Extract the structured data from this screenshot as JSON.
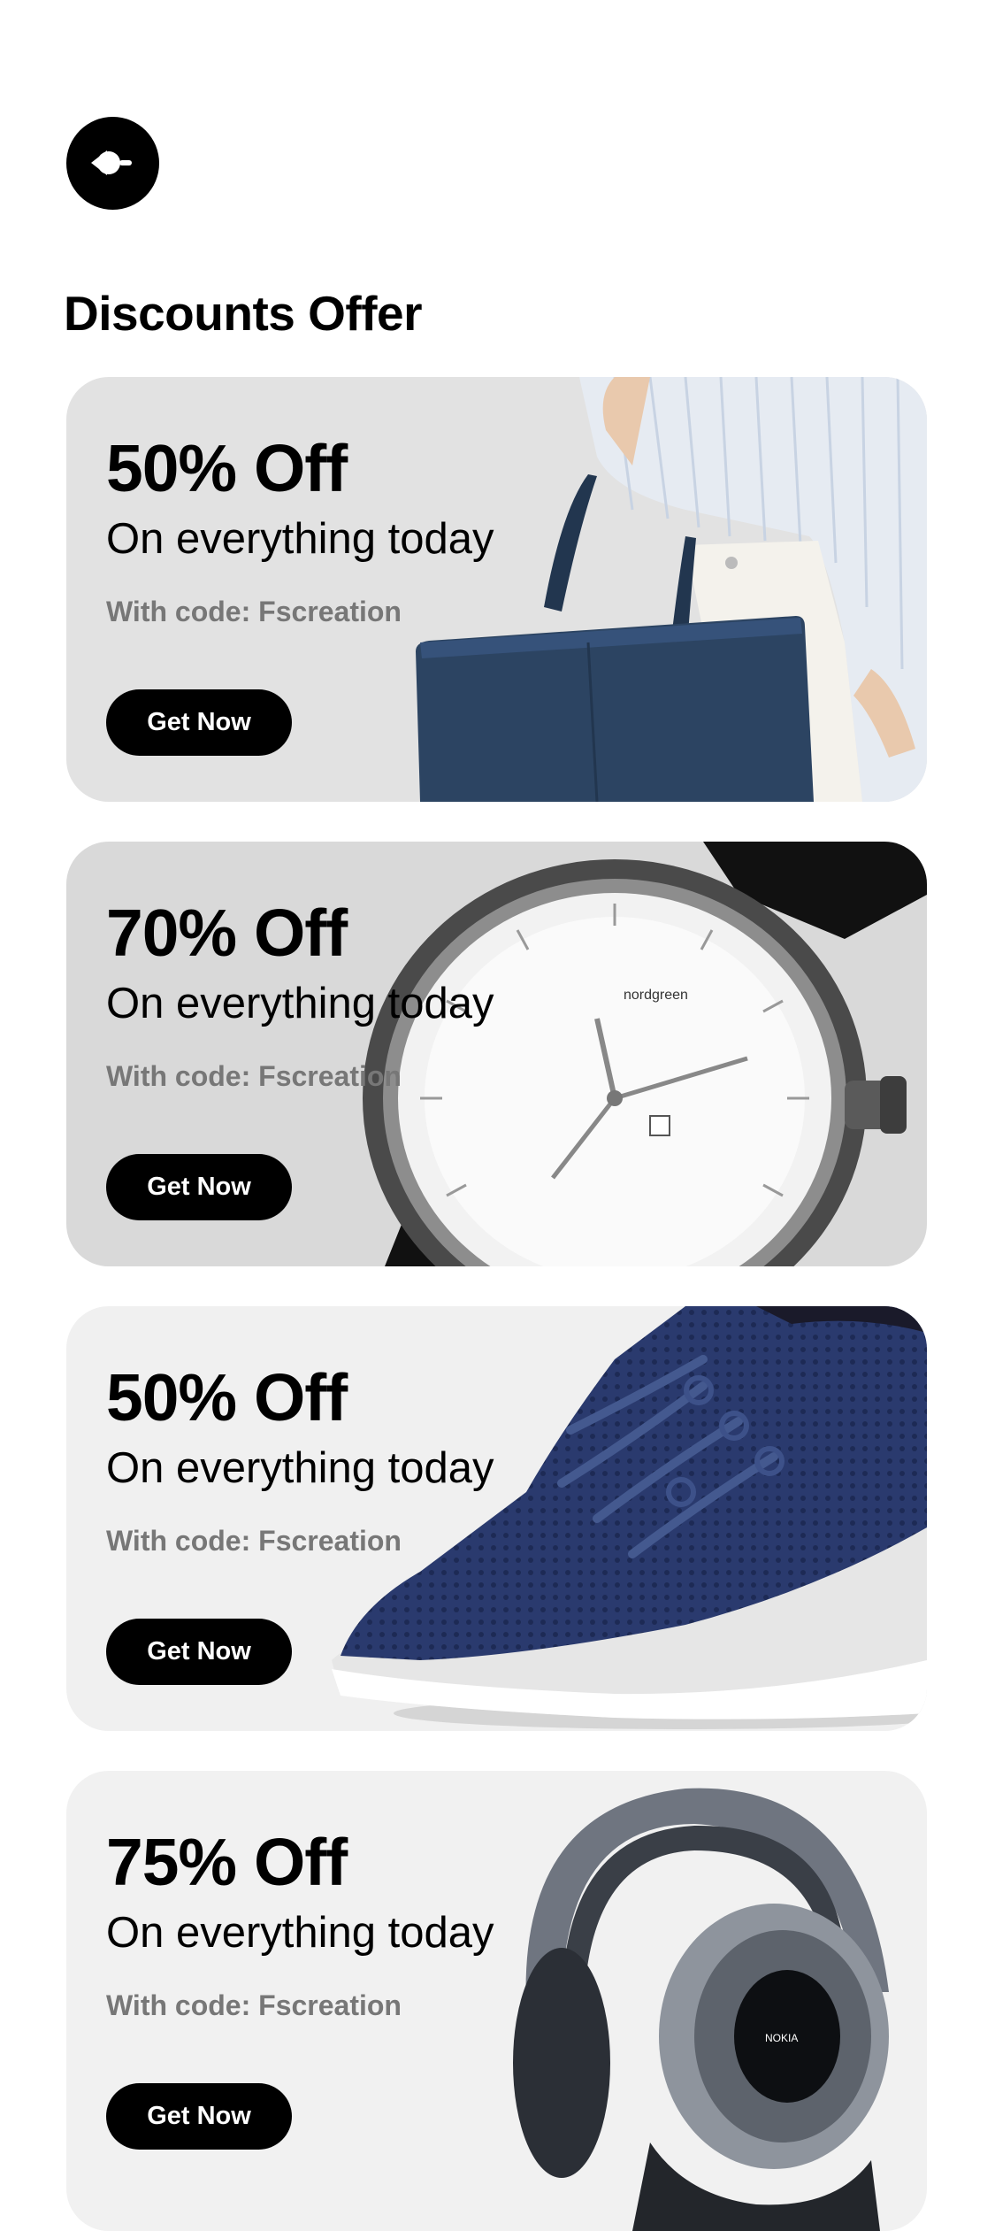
{
  "header": {
    "back_icon": "back-arrow-icon",
    "title": "Discounts Offer"
  },
  "offers": [
    {
      "percent": "50% Off",
      "subtitle": "On everything today",
      "code": "With code: Fscreation",
      "button": "Get Now",
      "image_icon": "tote-bag-icon",
      "bg": "#e2e2e2"
    },
    {
      "percent": "70% Off",
      "subtitle": "On everything today",
      "code": "With code: Fscreation",
      "button": "Get Now",
      "image_icon": "watch-icon",
      "bg": "#d9d9d9"
    },
    {
      "percent": "50% Off",
      "subtitle": "On everything today",
      "code": "With code: Fscreation",
      "button": "Get Now",
      "image_icon": "sneaker-icon",
      "bg": "#f0f0f0"
    },
    {
      "percent": "75% Off",
      "subtitle": "On everything today",
      "code": "With code: Fscreation",
      "button": "Get Now",
      "image_icon": "headphones-icon",
      "bg": "#f1f1f1"
    }
  ],
  "colors": {
    "accent": "#000000",
    "code_text": "#777777",
    "bag": "#2c4462",
    "shoe": "#2a3a6e"
  },
  "watch_brand": "nordgreen"
}
